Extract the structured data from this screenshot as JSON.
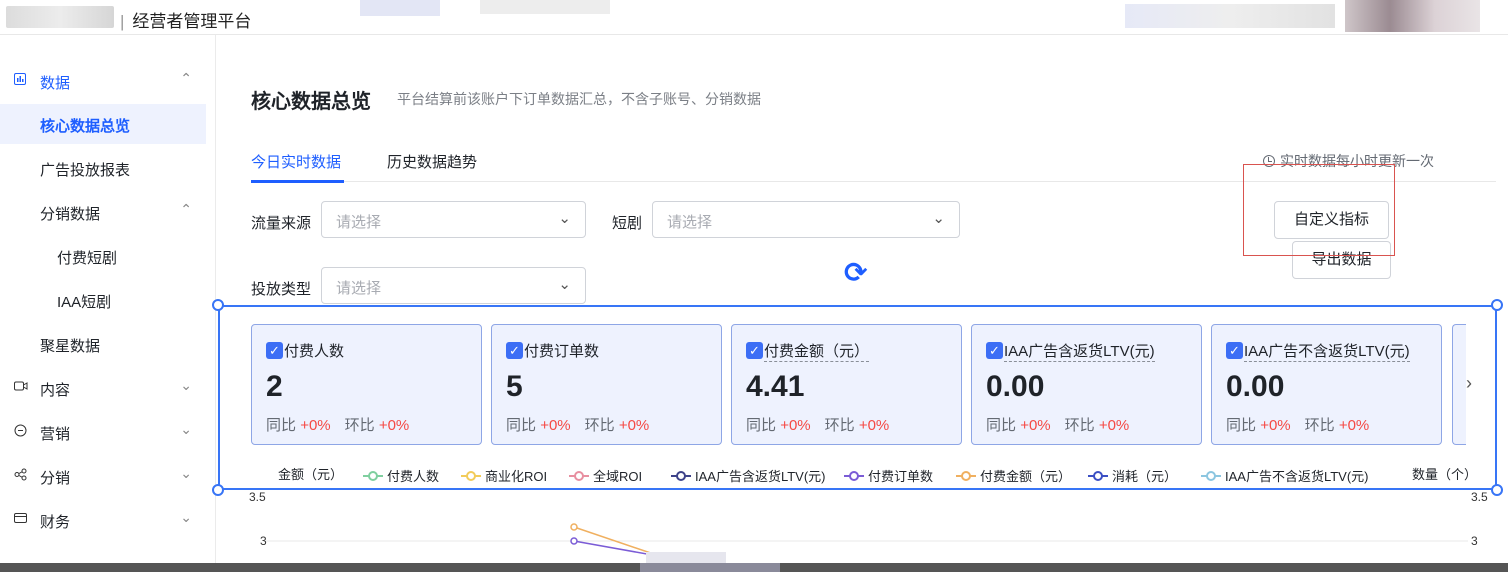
{
  "header": {
    "title": "经营者管理平台"
  },
  "sidebar": {
    "items": [
      {
        "label": "数据",
        "icon": "bar-chart-icon",
        "chevron": "⌃"
      },
      {
        "label": "核心数据总览"
      },
      {
        "label": "广告投放报表"
      },
      {
        "label": "分销数据",
        "chevron": "⌃"
      },
      {
        "label": "付费短剧"
      },
      {
        "label": "IAA短剧"
      },
      {
        "label": "聚星数据"
      },
      {
        "label": "内容",
        "icon": "video-icon",
        "chevron": "⌄"
      },
      {
        "label": "营销",
        "icon": "megaphone-icon",
        "chevron": "⌄"
      },
      {
        "label": "分销",
        "icon": "share-icon",
        "chevron": "⌄"
      },
      {
        "label": "财务",
        "icon": "wallet-icon",
        "chevron": "⌄"
      }
    ]
  },
  "page": {
    "title": "核心数据总览",
    "subtitle": "平台结算前该账户下订单数据汇总，不含子账号、分销数据"
  },
  "tabs": [
    {
      "label": "今日实时数据"
    },
    {
      "label": "历史数据趋势"
    }
  ],
  "update_note": "实时数据每小时更新一次",
  "filters": {
    "traffic_source": {
      "label": "流量来源",
      "placeholder": "请选择"
    },
    "short_drama": {
      "label": "短剧",
      "placeholder": "请选择"
    },
    "delivery_type": {
      "label": "投放类型",
      "placeholder": "请选择"
    }
  },
  "buttons": {
    "custom_metrics": "自定义指标",
    "export": "导出数据"
  },
  "icons": {
    "refresh": "⟳",
    "check": "✓",
    "next": "›",
    "chevron_down": "⌄"
  },
  "metrics": [
    {
      "title": "付费人数",
      "value": "2",
      "yoy_label": "同比",
      "yoy": "+0%",
      "mom_label": "环比",
      "mom": "+0%"
    },
    {
      "title": "付费订单数",
      "value": "5",
      "yoy_label": "同比",
      "yoy": "+0%",
      "mom_label": "环比",
      "mom": "+0%"
    },
    {
      "title": "付费金额（元）",
      "value": "4.41",
      "yoy_label": "同比",
      "yoy": "+0%",
      "mom_label": "环比",
      "mom": "+0%"
    },
    {
      "title": "IAA广告含返货LTV(元)",
      "value": "0.00",
      "yoy_label": "同比",
      "yoy": "+0%",
      "mom_label": "环比",
      "mom": "+0%"
    },
    {
      "title": "IAA广告不含返货LTV(元)",
      "value": "0.00",
      "yoy_label": "同比",
      "yoy": "+0%",
      "mom_label": "环比",
      "mom": "+0%"
    }
  ],
  "chart": {
    "left_axis": "金额（元）",
    "right_axis": "数量（个）",
    "legend": [
      {
        "name": "付费人数",
        "color": "#7fcf9f"
      },
      {
        "name": "商业化ROI",
        "color": "#f2cc5a"
      },
      {
        "name": "全域ROI",
        "color": "#e88fa0"
      },
      {
        "name": "IAA广告含返货LTV(元)",
        "color": "#3d4289"
      },
      {
        "name": "付费订单数",
        "color": "#7b5cd6"
      },
      {
        "name": "付费金额（元）",
        "color": "#f0b060"
      },
      {
        "name": "消耗（元）",
        "color": "#3b4fc4"
      },
      {
        "name": "IAA广告不含返货LTV(元)",
        "color": "#8cc6e0"
      }
    ],
    "y_ticks_left": [
      "3.5",
      "3"
    ],
    "y_ticks_right": [
      "3.5",
      "3"
    ]
  }
}
